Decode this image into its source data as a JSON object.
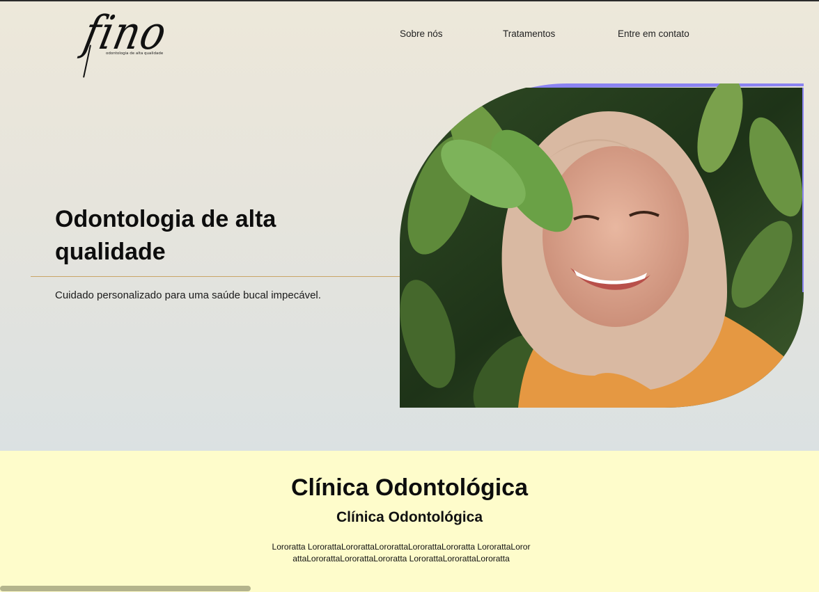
{
  "brand": {
    "logo_text": "fino",
    "tagline": "odontologia de alta qualidade"
  },
  "nav": {
    "items": [
      {
        "label": "Sobre nós"
      },
      {
        "label": "Tratamentos"
      },
      {
        "label": "Entre em contato"
      }
    ]
  },
  "hero": {
    "title": "Odontologia de alta qualidade",
    "subtitle": "Cuidado personalizado para uma saúde bucal impecável."
  },
  "section": {
    "title": "Clínica Odontológica",
    "subtitle": "Clínica Odontológica",
    "body": "Lororatta LororattaLororattaLororattaLororattaLororatta LororattaLororattaLororattaLororattaLororatta LororattaLororattaLororatta"
  },
  "colors": {
    "accent_purple": "#8b83f2",
    "divider_gold": "#c9a566",
    "section_bg": "#fefccb"
  }
}
